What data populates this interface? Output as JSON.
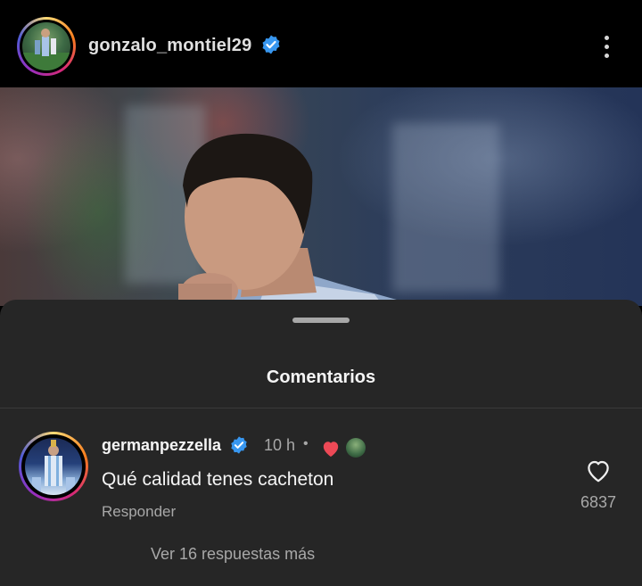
{
  "header": {
    "username": "gonzalo_montiel29",
    "verified": true,
    "avatar_icon": "profile-photo-avatar",
    "menu_icon": "more-options-icon"
  },
  "sheet": {
    "title": "Comentarios"
  },
  "comment": {
    "username": "germanpezzella",
    "verified": true,
    "time": "10 h",
    "separator": "•",
    "creator_liked": true,
    "text": "Qué calidad tenes cacheton",
    "reply_label": "Responder",
    "like_count": "6837",
    "view_replies": "Ver 16 respuestas más"
  },
  "colors": {
    "verified_blue": "#3897f0",
    "heart_red": "#ed4956",
    "sheet_bg": "#262626",
    "muted_text": "#a8a8a8"
  }
}
